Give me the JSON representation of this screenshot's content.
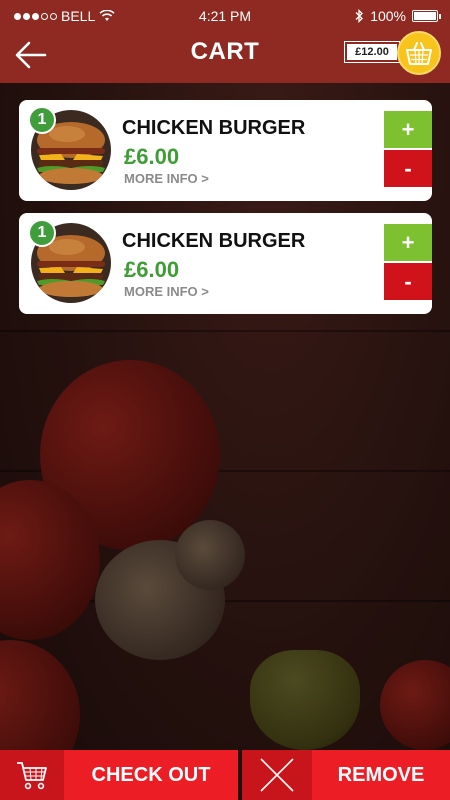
{
  "status_bar": {
    "carrier": "BELL",
    "time": "4:21 PM",
    "battery": "100%"
  },
  "header": {
    "title": "CART",
    "cart_total": "£12.00"
  },
  "cart_items": [
    {
      "quantity": "1",
      "name": "CHICKEN BURGER",
      "price": "£6.00",
      "more_info": "MORE INFO >",
      "plus_label": "+",
      "minus_label": "-"
    },
    {
      "quantity": "1",
      "name": "CHICKEN BURGER",
      "price": "£6.00",
      "more_info": "MORE INFO >",
      "plus_label": "+",
      "minus_label": "-"
    }
  ],
  "bottom_bar": {
    "checkout_label": "CHECK OUT",
    "remove_label": "REMOVE"
  },
  "icons": {
    "back": "arrow-left-icon",
    "basket": "basket-icon",
    "checkout": "shopping-cart-icon",
    "remove": "close-icon",
    "signal": "signal-dots-icon",
    "wifi": "wifi-icon",
    "bluetooth": "bluetooth-icon",
    "battery": "battery-icon"
  },
  "colors": {
    "header": "#8e2a22",
    "price_green": "#3e9d33",
    "plus_green": "#7dc131",
    "minus_red": "#d0121a",
    "action_red": "#ec1d24",
    "basket_yellow": "#f8c31b"
  }
}
